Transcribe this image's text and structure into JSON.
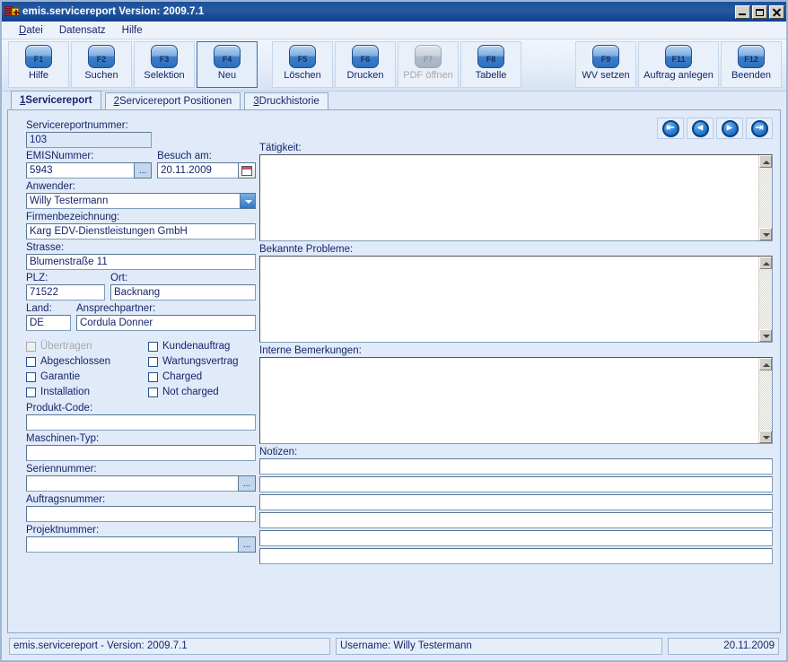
{
  "window": {
    "title": "emis.servicereport Version: 2009.7.1",
    "icon": "app-icon",
    "minimize_label": "_",
    "maximize_label": "□",
    "close_label": "✕"
  },
  "menu": {
    "items": [
      {
        "label": "Datei",
        "accel": "D",
        "rest": "atei"
      },
      {
        "label": "Datensatz",
        "accel": "",
        "rest": "Datensatz"
      },
      {
        "label": "Hilfe",
        "accel": "",
        "rest": "Hilfe"
      }
    ]
  },
  "toolbar": {
    "groups": [
      {
        "buttons": [
          {
            "key": "F1",
            "label": "Hilfe",
            "disabled": false,
            "selected": false
          },
          {
            "key": "F2",
            "label": "Suchen",
            "disabled": false,
            "selected": false
          },
          {
            "key": "F3",
            "label": "Selektion",
            "disabled": false,
            "selected": false
          },
          {
            "key": "F4",
            "label": "Neu",
            "disabled": false,
            "selected": true
          }
        ]
      },
      {
        "buttons": [
          {
            "key": "F5",
            "label": "Löschen",
            "disabled": false,
            "selected": false
          },
          {
            "key": "F6",
            "label": "Drucken",
            "disabled": false,
            "selected": false
          },
          {
            "key": "F7",
            "label": "PDF öffnen",
            "disabled": true,
            "selected": false
          },
          {
            "key": "F8",
            "label": "Tabelle",
            "disabled": false,
            "selected": false
          }
        ]
      },
      {
        "buttons": [
          {
            "key": "F9",
            "label": "WV setzen",
            "disabled": false,
            "selected": false
          },
          {
            "key": "F11",
            "label": "Auftrag anlegen",
            "disabled": false,
            "selected": false
          },
          {
            "key": "F12",
            "label": "Beenden",
            "disabled": false,
            "selected": false
          }
        ]
      }
    ]
  },
  "tabs": [
    {
      "num": "1",
      "label": " Servicereport",
      "active": true
    },
    {
      "num": "2",
      "label": " Servicereport Positionen",
      "active": false
    },
    {
      "num": "3",
      "label": " Druckhistorie",
      "active": false
    }
  ],
  "form": {
    "servicereportnummer": {
      "label": "Servicereportnummer:",
      "value": "103",
      "readonly": true
    },
    "emisnummer": {
      "label": "EMISNummer:",
      "value": "5943",
      "button": "..."
    },
    "besuch_am": {
      "label": "Besuch am:",
      "value": "20.11.2009",
      "button": "calendar-icon"
    },
    "anwender": {
      "label": "Anwender:",
      "value": "Willy Testermann"
    },
    "firmenbezeichnung": {
      "label": "Firmenbezeichnung:",
      "value": "Karg EDV-Dienstleistungen GmbH"
    },
    "strasse": {
      "label": "Strasse:",
      "value": "Blumenstraße 11"
    },
    "plz": {
      "label": "PLZ:",
      "value": "71522"
    },
    "ort": {
      "label": "Ort:",
      "value": "Backnang"
    },
    "land": {
      "label": "Land:",
      "value": "DE"
    },
    "ansprechpartner": {
      "label": "Ansprechpartner:",
      "value": "Cordula Donner"
    },
    "produkt_code": {
      "label": "Produkt-Code:",
      "value": ""
    },
    "maschinen_typ": {
      "label": "Maschinen-Typ:",
      "value": ""
    },
    "seriennummer": {
      "label": "Seriennummer:",
      "value": "",
      "button": "..."
    },
    "auftragsnummer": {
      "label": "Auftragsnummer:",
      "value": ""
    },
    "projektnummer": {
      "label": "Projektnummer:",
      "value": "",
      "button": "..."
    }
  },
  "checkboxes": [
    {
      "label": "Übertragen",
      "checked": false,
      "disabled": true
    },
    {
      "label": "Kundenauftrag",
      "checked": false,
      "disabled": false
    },
    {
      "label": "Abgeschlossen",
      "checked": false,
      "disabled": false
    },
    {
      "label": "Wartungsvertrag",
      "checked": false,
      "disabled": false
    },
    {
      "label": "Garantie",
      "checked": false,
      "disabled": false
    },
    {
      "label": "Charged",
      "checked": false,
      "disabled": false
    },
    {
      "label": "Installation",
      "checked": false,
      "disabled": false
    },
    {
      "label": "Not charged",
      "checked": false,
      "disabled": false
    }
  ],
  "nav_buttons": [
    {
      "name": "first-record",
      "glyph": "⇤"
    },
    {
      "name": "previous-record",
      "glyph": "◄"
    },
    {
      "name": "next-record",
      "glyph": "►"
    },
    {
      "name": "last-record",
      "glyph": "⇥"
    }
  ],
  "textareas": {
    "taetigkeit": {
      "label": "Tätigkeit:",
      "value": ""
    },
    "bekannte_probleme": {
      "label": "Bekannte Probleme:",
      "value": ""
    },
    "interne_bemerkungen": {
      "label": "Interne Bemerkungen:",
      "value": ""
    }
  },
  "notizen": {
    "label": "Notizen:",
    "rows": [
      "",
      "",
      "",
      "",
      "",
      ""
    ]
  },
  "statusbar": {
    "left": "emis.servicereport - Version: 2009.7.1",
    "middle": "Username: Willy Testermann",
    "right": "20.11.2009"
  },
  "colors": {
    "title_bar": "#1c4f9c",
    "panel_bg": "#e0eaf8",
    "label_text": "#16256b",
    "accent": "#2d77c4",
    "disabled_text": "#a9a9a9"
  }
}
